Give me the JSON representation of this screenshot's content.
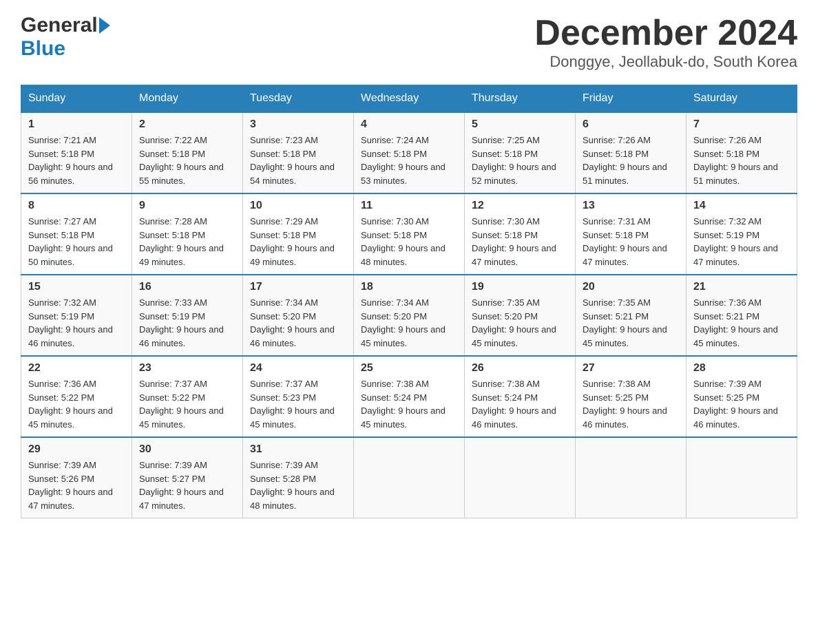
{
  "header": {
    "logo_general": "General",
    "logo_blue": "Blue",
    "month_title": "December 2024",
    "location": "Donggye, Jeollabuk-do, South Korea"
  },
  "days_of_week": [
    "Sunday",
    "Monday",
    "Tuesday",
    "Wednesday",
    "Thursday",
    "Friday",
    "Saturday"
  ],
  "weeks": [
    {
      "days": [
        {
          "number": "1",
          "sunrise": "7:21 AM",
          "sunset": "5:18 PM",
          "daylight": "9 hours and 56 minutes."
        },
        {
          "number": "2",
          "sunrise": "7:22 AM",
          "sunset": "5:18 PM",
          "daylight": "9 hours and 55 minutes."
        },
        {
          "number": "3",
          "sunrise": "7:23 AM",
          "sunset": "5:18 PM",
          "daylight": "9 hours and 54 minutes."
        },
        {
          "number": "4",
          "sunrise": "7:24 AM",
          "sunset": "5:18 PM",
          "daylight": "9 hours and 53 minutes."
        },
        {
          "number": "5",
          "sunrise": "7:25 AM",
          "sunset": "5:18 PM",
          "daylight": "9 hours and 52 minutes."
        },
        {
          "number": "6",
          "sunrise": "7:26 AM",
          "sunset": "5:18 PM",
          "daylight": "9 hours and 51 minutes."
        },
        {
          "number": "7",
          "sunrise": "7:26 AM",
          "sunset": "5:18 PM",
          "daylight": "9 hours and 51 minutes."
        }
      ]
    },
    {
      "days": [
        {
          "number": "8",
          "sunrise": "7:27 AM",
          "sunset": "5:18 PM",
          "daylight": "9 hours and 50 minutes."
        },
        {
          "number": "9",
          "sunrise": "7:28 AM",
          "sunset": "5:18 PM",
          "daylight": "9 hours and 49 minutes."
        },
        {
          "number": "10",
          "sunrise": "7:29 AM",
          "sunset": "5:18 PM",
          "daylight": "9 hours and 49 minutes."
        },
        {
          "number": "11",
          "sunrise": "7:30 AM",
          "sunset": "5:18 PM",
          "daylight": "9 hours and 48 minutes."
        },
        {
          "number": "12",
          "sunrise": "7:30 AM",
          "sunset": "5:18 PM",
          "daylight": "9 hours and 47 minutes."
        },
        {
          "number": "13",
          "sunrise": "7:31 AM",
          "sunset": "5:18 PM",
          "daylight": "9 hours and 47 minutes."
        },
        {
          "number": "14",
          "sunrise": "7:32 AM",
          "sunset": "5:19 PM",
          "daylight": "9 hours and 47 minutes."
        }
      ]
    },
    {
      "days": [
        {
          "number": "15",
          "sunrise": "7:32 AM",
          "sunset": "5:19 PM",
          "daylight": "9 hours and 46 minutes."
        },
        {
          "number": "16",
          "sunrise": "7:33 AM",
          "sunset": "5:19 PM",
          "daylight": "9 hours and 46 minutes."
        },
        {
          "number": "17",
          "sunrise": "7:34 AM",
          "sunset": "5:20 PM",
          "daylight": "9 hours and 46 minutes."
        },
        {
          "number": "18",
          "sunrise": "7:34 AM",
          "sunset": "5:20 PM",
          "daylight": "9 hours and 45 minutes."
        },
        {
          "number": "19",
          "sunrise": "7:35 AM",
          "sunset": "5:20 PM",
          "daylight": "9 hours and 45 minutes."
        },
        {
          "number": "20",
          "sunrise": "7:35 AM",
          "sunset": "5:21 PM",
          "daylight": "9 hours and 45 minutes."
        },
        {
          "number": "21",
          "sunrise": "7:36 AM",
          "sunset": "5:21 PM",
          "daylight": "9 hours and 45 minutes."
        }
      ]
    },
    {
      "days": [
        {
          "number": "22",
          "sunrise": "7:36 AM",
          "sunset": "5:22 PM",
          "daylight": "9 hours and 45 minutes."
        },
        {
          "number": "23",
          "sunrise": "7:37 AM",
          "sunset": "5:22 PM",
          "daylight": "9 hours and 45 minutes."
        },
        {
          "number": "24",
          "sunrise": "7:37 AM",
          "sunset": "5:23 PM",
          "daylight": "9 hours and 45 minutes."
        },
        {
          "number": "25",
          "sunrise": "7:38 AM",
          "sunset": "5:24 PM",
          "daylight": "9 hours and 45 minutes."
        },
        {
          "number": "26",
          "sunrise": "7:38 AM",
          "sunset": "5:24 PM",
          "daylight": "9 hours and 46 minutes."
        },
        {
          "number": "27",
          "sunrise": "7:38 AM",
          "sunset": "5:25 PM",
          "daylight": "9 hours and 46 minutes."
        },
        {
          "number": "28",
          "sunrise": "7:39 AM",
          "sunset": "5:25 PM",
          "daylight": "9 hours and 46 minutes."
        }
      ]
    },
    {
      "days": [
        {
          "number": "29",
          "sunrise": "7:39 AM",
          "sunset": "5:26 PM",
          "daylight": "9 hours and 47 minutes."
        },
        {
          "number": "30",
          "sunrise": "7:39 AM",
          "sunset": "5:27 PM",
          "daylight": "9 hours and 47 minutes."
        },
        {
          "number": "31",
          "sunrise": "7:39 AM",
          "sunset": "5:28 PM",
          "daylight": "9 hours and 48 minutes."
        },
        null,
        null,
        null,
        null
      ]
    }
  ],
  "labels": {
    "sunrise_prefix": "Sunrise: ",
    "sunset_prefix": "Sunset: ",
    "daylight_prefix": "Daylight: "
  },
  "colors": {
    "header_bg": "#2980b9",
    "header_text": "#ffffff",
    "border": "#ccc",
    "text": "#333"
  }
}
